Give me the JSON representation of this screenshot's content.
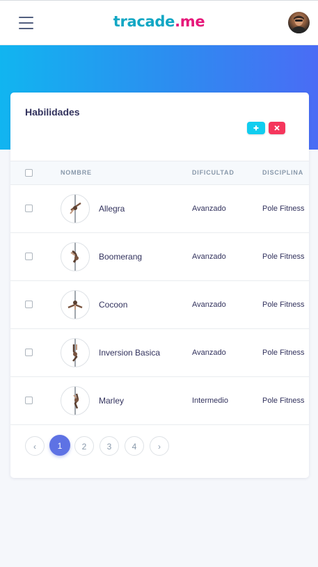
{
  "header": {
    "brand_part1": "tracade",
    "brand_part2": ".me",
    "brand_colors": [
      "#12a7c4",
      "#e6197a"
    ]
  },
  "card": {
    "title": "Habilidades",
    "add_icon": "plus-icon",
    "delete_icon": "times-icon"
  },
  "table": {
    "columns": [
      "NOMBRE",
      "DIFICULTAD",
      "DISCIPLINA"
    ],
    "rows": [
      {
        "name": "Allegra",
        "difficulty": "Avanzado",
        "discipline": "Pole Fitness"
      },
      {
        "name": "Boomerang",
        "difficulty": "Avanzado",
        "discipline": "Pole Fitness"
      },
      {
        "name": "Cocoon",
        "difficulty": "Avanzado",
        "discipline": "Pole Fitness"
      },
      {
        "name": "Inversion Basica",
        "difficulty": "Avanzado",
        "discipline": "Pole Fitness"
      },
      {
        "name": "Marley",
        "difficulty": "Intermedio",
        "discipline": "Pole Fitness"
      }
    ]
  },
  "pagination": {
    "prev": "‹",
    "pages": [
      "1",
      "2",
      "3",
      "4"
    ],
    "next": "›",
    "active": "1"
  },
  "colors": {
    "hero_start": "#11b5f0",
    "hero_end": "#4a6cf5",
    "accent": "#5e72e4",
    "info": "#11cdef",
    "danger": "#f5365c"
  }
}
